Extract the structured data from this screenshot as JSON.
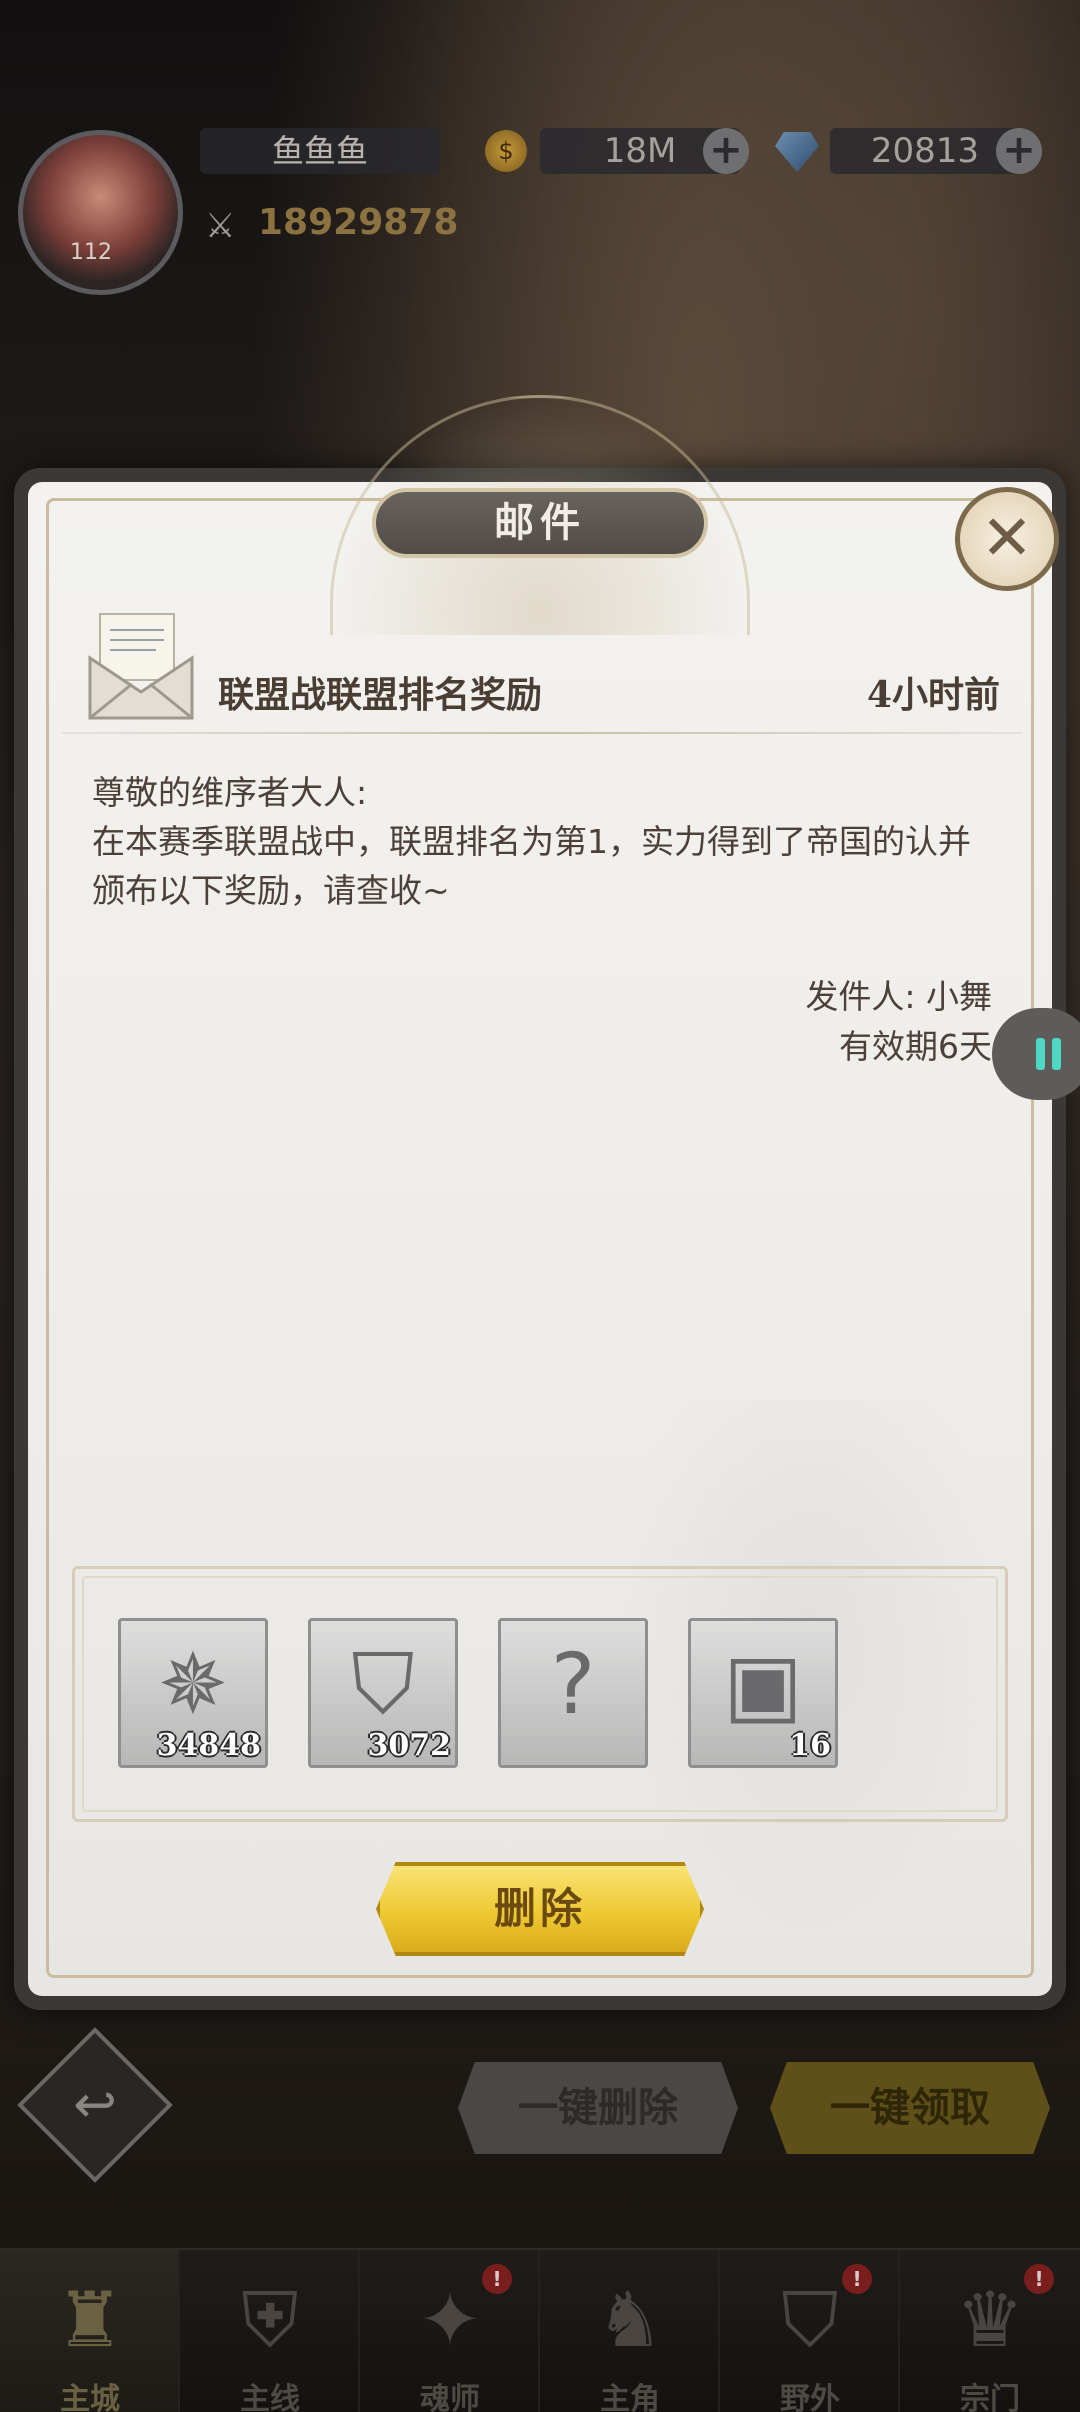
{
  "player": {
    "name": "鱼鱼鱼",
    "level": "112",
    "gold": "18M",
    "diamonds": "20813",
    "power": "18929878"
  },
  "mail_dialog": {
    "title": "邮件",
    "subject": "联盟战联盟排名奖励",
    "time": "4小时前",
    "greeting": "尊敬的维序者大人:",
    "body": "在本赛季联盟战中，联盟排名为第1，实力得到了帝国的认并颁布以下奖励，请查收~",
    "sender": "发件人: 小舞",
    "validity": "有效期6天",
    "rewards": [
      {
        "icon": "star-emblem-icon",
        "glyph": "✵",
        "qty": "34848"
      },
      {
        "icon": "shield-emblem-icon",
        "glyph": "⛉",
        "qty": "3072"
      },
      {
        "icon": "mystery-book-icon",
        "glyph": "?",
        "qty": ""
      },
      {
        "icon": "treasure-chest-icon",
        "glyph": "▣",
        "qty": "16"
      }
    ],
    "delete_label": "删除"
  },
  "footer_actions": {
    "back_glyph": "↩",
    "bulk_delete_label": "一键删除",
    "bulk_claim_label": "一键领取"
  },
  "nav": [
    {
      "label": "主城",
      "icon": "castle-icon",
      "glyph": "♜",
      "badge": ""
    },
    {
      "label": "主线",
      "icon": "storyline-icon",
      "glyph": "⛨",
      "badge": ""
    },
    {
      "label": "魂师",
      "icon": "spirit-master-icon",
      "glyph": "✦",
      "badge": "!"
    },
    {
      "label": "主角",
      "icon": "protagonist-icon",
      "glyph": "♞",
      "badge": ""
    },
    {
      "label": "野外",
      "icon": "wilderness-icon",
      "glyph": "⛉",
      "badge": "!"
    },
    {
      "label": "宗门",
      "icon": "sect-icon",
      "glyph": "♛",
      "badge": "!"
    }
  ],
  "colors": {
    "accent_gold": "#efc932",
    "teal_handle": "#4fd7c6",
    "text_brown": "#4a3d33"
  }
}
